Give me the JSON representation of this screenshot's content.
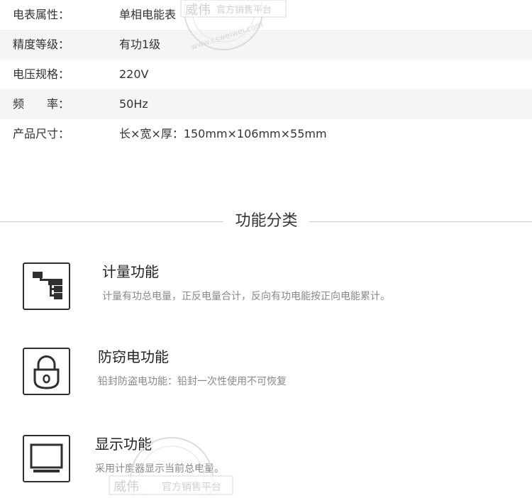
{
  "specs": [
    {
      "key": "电表属性：",
      "value": "单相电能表"
    },
    {
      "key": "精度等级：",
      "value": "有功1级"
    },
    {
      "key": "电压规格：",
      "value": "220V"
    },
    {
      "key": "频　　率：",
      "value": "50Hz"
    },
    {
      "key": "产品尺寸：",
      "value": "长×宽×厚：150mm×106mm×55mm"
    }
  ],
  "section": {
    "title": "功能分类"
  },
  "features": [
    {
      "title": "计量功能",
      "desc": "计量有功总电量，正反电量合计，反向有功电能按正向电能累计。",
      "icon": "flowchart-icon"
    },
    {
      "title": "防窃电功能",
      "desc": "铅封防盗电功能：铅封一次性使用不可恢复",
      "icon": "padlock-icon"
    },
    {
      "title": "显示功能",
      "desc": "采用计度器显示当前总电量。",
      "icon": "monitor-icon"
    }
  ],
  "watermark": {
    "brand": "威伟",
    "platform": "官方销售平台",
    "url": "www.csweiwei.com"
  },
  "colors": {
    "shaded_row": "#f5f5f5",
    "icon_stroke": "#2f2f2f",
    "muted_text": "#888888"
  }
}
